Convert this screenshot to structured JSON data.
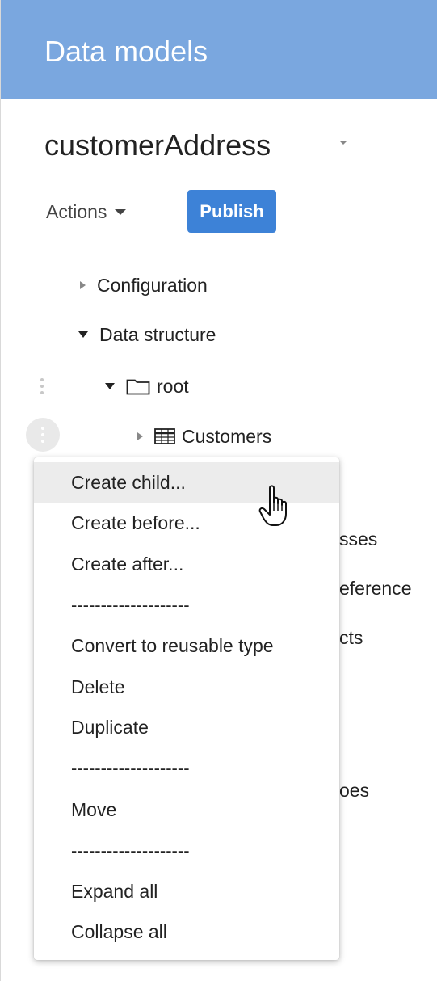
{
  "header": {
    "title": "Data models"
  },
  "model": {
    "name": "customerAddress"
  },
  "toolbar": {
    "actions_label": "Actions",
    "publish_label": "Publish"
  },
  "tree": {
    "configuration": "Configuration",
    "data_structure": "Data structure",
    "root": "root",
    "customers": "Customers"
  },
  "background_fragments": {
    "frag1": "sses",
    "frag2": "eference",
    "frag3": "cts",
    "frag4": "oes"
  },
  "context_menu": {
    "create_child": "Create child...",
    "create_before": "Create before...",
    "create_after": "Create after...",
    "separator": "--------------------",
    "convert": "Convert to reusable type",
    "delete": "Delete",
    "duplicate": "Duplicate",
    "move": "Move",
    "expand_all": "Expand all",
    "collapse_all": "Collapse all"
  },
  "colors": {
    "header_bg": "#7aa7df",
    "publish_bg": "#3d82d7",
    "menu_hover": "#ececec"
  },
  "icons": {
    "model_caret": "chevron-down-icon",
    "actions_caret": "caret-down-icon",
    "collapsed": "triangle-right-icon",
    "expanded": "triangle-down-icon",
    "folder": "folder-icon",
    "table": "table-icon",
    "more": "kebab-icon",
    "cursor": "hand-pointer-icon"
  }
}
